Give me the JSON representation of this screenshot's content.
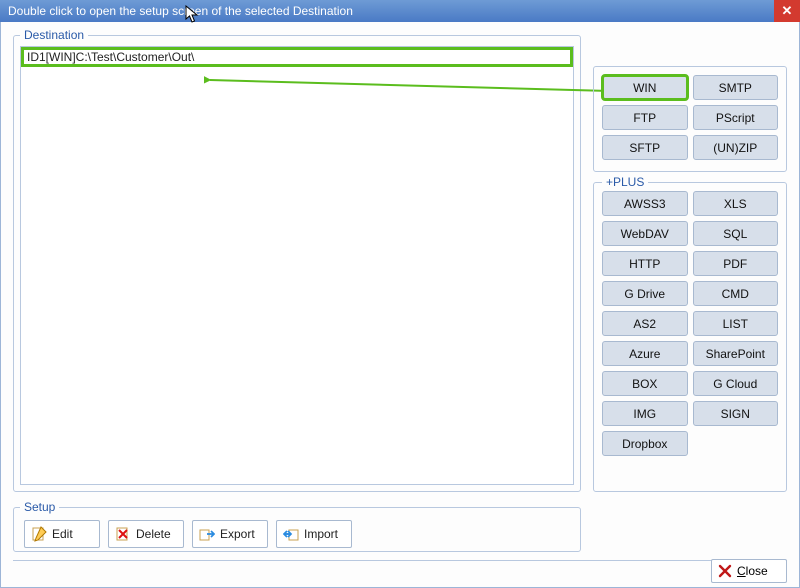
{
  "window": {
    "title": "Double click to open the setup screen of the selected Destination"
  },
  "destination": {
    "legend": "Destination",
    "items": [
      {
        "label": "ID1[WIN]C:\\Test\\Customer\\Out\\",
        "highlight": true
      }
    ]
  },
  "types_core": [
    {
      "label": "WIN",
      "highlight": true
    },
    {
      "label": "SMTP"
    },
    {
      "label": "FTP"
    },
    {
      "label": "PScript"
    },
    {
      "label": "SFTP"
    },
    {
      "label": "(UN)ZIP"
    }
  ],
  "types_plus_label": "+PLUS",
  "types_plus": [
    {
      "label": "AWSS3"
    },
    {
      "label": "XLS"
    },
    {
      "label": "WebDAV"
    },
    {
      "label": "SQL"
    },
    {
      "label": "HTTP"
    },
    {
      "label": "PDF"
    },
    {
      "label": "G Drive"
    },
    {
      "label": "CMD"
    },
    {
      "label": "AS2"
    },
    {
      "label": "LIST"
    },
    {
      "label": "Azure"
    },
    {
      "label": "SharePoint"
    },
    {
      "label": "BOX"
    },
    {
      "label": "G Cloud"
    },
    {
      "label": "IMG"
    },
    {
      "label": "SIGN"
    },
    {
      "label": "Dropbox"
    }
  ],
  "setup": {
    "legend": "Setup",
    "buttons": {
      "edit": "Edit",
      "delete": "Delete",
      "export": "Export",
      "import": "Import"
    }
  },
  "close_label": "Close"
}
